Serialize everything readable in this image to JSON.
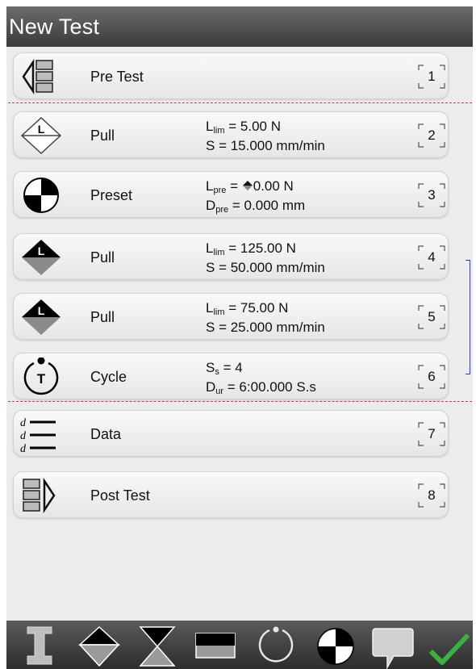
{
  "header": {
    "title": "New Test"
  },
  "steps": [
    {
      "name": "Pre Test",
      "number": "1",
      "icon": "pre-test-icon"
    },
    {
      "name": "Pull",
      "number": "2",
      "icon": "pull-icon",
      "p1_sym": "L",
      "p1_sub": "lim",
      "p1_val": " = 5.00 N",
      "p2_sym": "S",
      "p2_sub": "",
      "p2_val": " = 15.000 mm/min"
    },
    {
      "name": "Preset",
      "number": "3",
      "icon": "preset-icon",
      "p1_sym": "L",
      "p1_sub": "pre",
      "p1_val": "0.00 N",
      "p1_eq": " = ",
      "p2_sym": "D",
      "p2_sub": "pre",
      "p2_val": " = 0.000 mm"
    },
    {
      "name": "Pull",
      "number": "4",
      "icon": "pull-icon",
      "p1_sym": "L",
      "p1_sub": "lim",
      "p1_val": " = 125.00 N",
      "p2_sym": "S",
      "p2_sub": "",
      "p2_val": " = 50.000 mm/min"
    },
    {
      "name": "Pull",
      "number": "5",
      "icon": "pull-icon",
      "p1_sym": "L",
      "p1_sub": "lim",
      "p1_val": " = 75.00 N",
      "p2_sym": "S",
      "p2_sub": "",
      "p2_val": " = 25.000 mm/min"
    },
    {
      "name": "Cycle",
      "number": "6",
      "icon": "cycle-icon",
      "p1_sym": "S",
      "p1_sub": "s",
      "p1_val": " = 4",
      "p2_sym": "D",
      "p2_sub": "ur",
      "p2_val": " = 6:00.000 S.s"
    },
    {
      "name": "Data",
      "number": "7",
      "icon": "data-icon",
      "data_letter": "d"
    },
    {
      "name": "Post Test",
      "number": "8",
      "icon": "post-test-icon"
    }
  ],
  "toolbar": {
    "items": [
      "specimen-icon",
      "pull-icon",
      "hold-icon",
      "preset-block-icon",
      "cycle-icon",
      "preset-icon",
      "comment-icon",
      "confirm-icon"
    ]
  },
  "colors": {
    "accent_confirm": "#3cb043",
    "divider": "#d43a3a",
    "bracket": "#2b3fcf"
  }
}
